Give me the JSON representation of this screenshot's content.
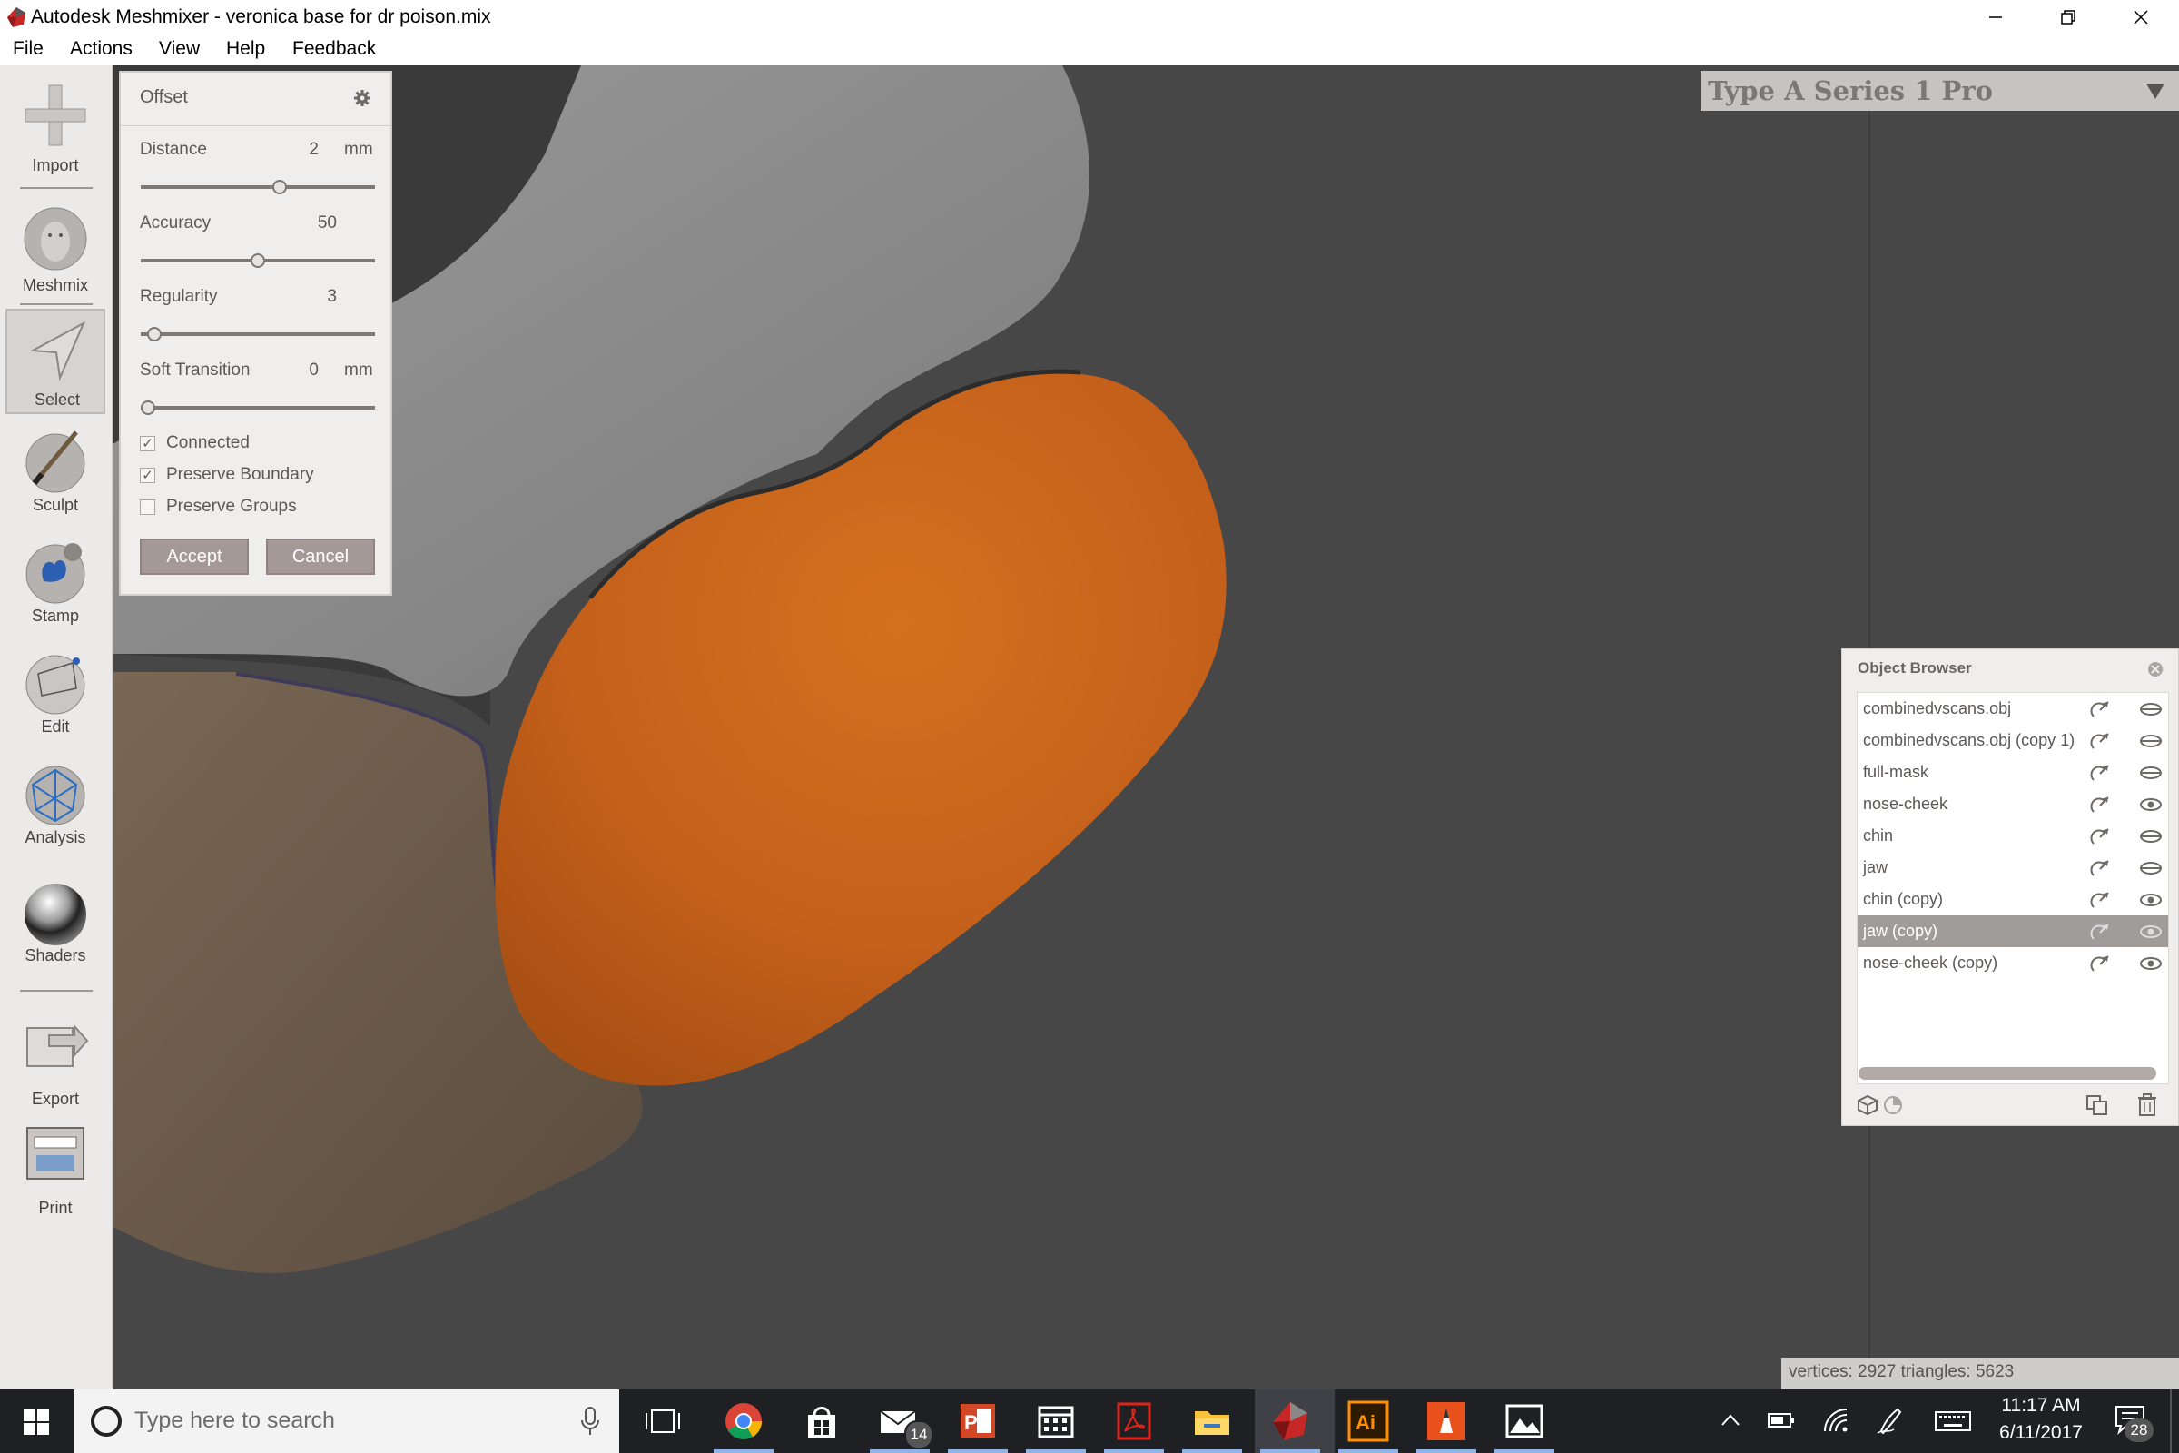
{
  "window": {
    "title": "Autodesk Meshmixer - veronica base for dr poison.mix",
    "minimize_icon": "minimize-icon",
    "restore_icon": "restore-icon",
    "close_icon": "close-icon"
  },
  "menu": [
    "File",
    "Actions",
    "View",
    "Help",
    "Feedback"
  ],
  "toolbar": {
    "tools": [
      {
        "label": "Import",
        "icon": "plus-icon"
      },
      {
        "label": "Meshmix",
        "icon": "face-sphere-icon"
      },
      {
        "label": "Select",
        "icon": "arrow-cursor-icon",
        "active": true
      },
      {
        "label": "Sculpt",
        "icon": "brush-sphere-icon"
      },
      {
        "label": "Stamp",
        "icon": "stamp-sphere-icon"
      },
      {
        "label": "Edit",
        "icon": "edit-sphere-icon"
      },
      {
        "label": "Analysis",
        "icon": "mesh-sphere-icon"
      },
      {
        "label": "Shaders",
        "icon": "chrome-sphere-icon"
      },
      {
        "label": "Export",
        "icon": "export-icon"
      },
      {
        "label": "Print",
        "icon": "printer-icon"
      }
    ]
  },
  "offset_panel": {
    "title": "Offset",
    "settings_icon": "gear-icon",
    "params": [
      {
        "label": "Distance",
        "value": "2",
        "unit": "mm",
        "slider_fraction": 0.6
      },
      {
        "label": "Accuracy",
        "value": "50",
        "unit": "",
        "slider_fraction": 0.5
      },
      {
        "label": "Regularity",
        "value": "3",
        "unit": "",
        "slider_fraction": 0.03
      },
      {
        "label": "Soft Transition",
        "value": "0",
        "unit": "mm",
        "slider_fraction": 0.0
      }
    ],
    "checkboxes": [
      {
        "label": "Connected",
        "checked": true
      },
      {
        "label": "Preserve Boundary",
        "checked": true
      },
      {
        "label": "Preserve Groups",
        "checked": false
      }
    ],
    "accept_label": "Accept",
    "cancel_label": "Cancel"
  },
  "printer": {
    "name": "Type A Series 1 Pro",
    "dropdown_icon": "triangle-down-icon"
  },
  "object_browser": {
    "title": "Object Browser",
    "close_icon": "close-circle-icon",
    "items": [
      {
        "name": "combinedvscans.obj",
        "visible": false,
        "selected": false
      },
      {
        "name": "combinedvscans.obj (copy 1)",
        "visible": false,
        "selected": false
      },
      {
        "name": "full-mask",
        "visible": false,
        "selected": false
      },
      {
        "name": "nose-cheek",
        "visible": true,
        "selected": false
      },
      {
        "name": "chin",
        "visible": false,
        "selected": false
      },
      {
        "name": "jaw",
        "visible": false,
        "selected": false
      },
      {
        "name": "chin (copy)",
        "visible": true,
        "selected": false
      },
      {
        "name": "jaw (copy)",
        "visible": true,
        "selected": true
      },
      {
        "name": "nose-cheek (copy)",
        "visible": true,
        "selected": false
      }
    ],
    "footer_icons": [
      "cube-icon",
      "pie-icon",
      "duplicate-icon",
      "trash-icon"
    ]
  },
  "status": {
    "text": "vertices: 2927 triangles: 5623"
  },
  "taskbar": {
    "search_placeholder": "Type here to search",
    "mail_badge": "14",
    "time": "11:17 AM",
    "date": "6/11/2017",
    "notification_badge": "28",
    "apps": [
      "chrome-icon",
      "store-icon",
      "mail-icon",
      "powerpoint-icon",
      "calendar-icon",
      "acrobat-icon",
      "file-explorer-icon",
      "meshmixer-icon",
      "illustrator-icon",
      "sketchbook-icon",
      "photos-icon"
    ]
  },
  "colors": {
    "viewport_bg": "#474747",
    "orange_mesh": "#c8611a",
    "gray_mesh": "#8a8a8a",
    "tan_mesh": "#6b5b4b",
    "button_bg": "#a59997"
  }
}
